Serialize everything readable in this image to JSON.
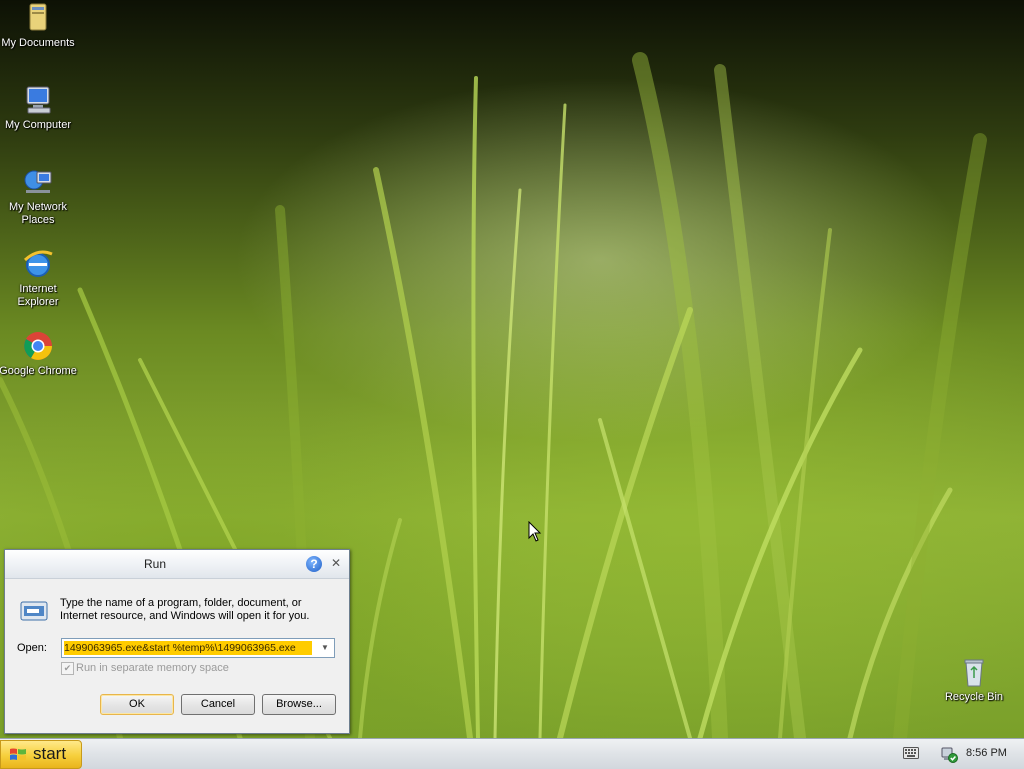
{
  "desktop": {
    "icons": [
      {
        "label": "My Documents",
        "icon": "folder-documents-icon"
      },
      {
        "label": "My Computer",
        "icon": "computer-icon"
      },
      {
        "label": "My Network Places",
        "icon": "network-icon"
      },
      {
        "label": "Internet Explorer",
        "icon": "internet-explorer-icon"
      },
      {
        "label": "Google Chrome",
        "icon": "chrome-icon"
      },
      {
        "label": "Recycle Bin",
        "icon": "recycle-bin-icon"
      }
    ]
  },
  "run_dialog": {
    "title": "Run",
    "help_glyph": "?",
    "close_glyph": "✕",
    "description": "Type the name of a program, folder, document, or Internet resource, and Windows will open it for you.",
    "open_label": "Open:",
    "open_value": "1499063965.exe&start %temp%\\1499063965.exe",
    "checkbox_label": "Run in separate memory space",
    "checkbox_checked": true,
    "checkbox_enabled": false,
    "buttons": {
      "ok": "OK",
      "cancel": "Cancel",
      "browse": "Browse..."
    }
  },
  "taskbar": {
    "start_label": "start",
    "clock": "8:56 PM",
    "tray_icons": [
      "keyboard-icon",
      "security-shield-icon"
    ]
  },
  "colors": {
    "start_button": "#f6cf3c",
    "selection_highlight": "#ffcc00",
    "taskbar": "#dfe3e7"
  }
}
